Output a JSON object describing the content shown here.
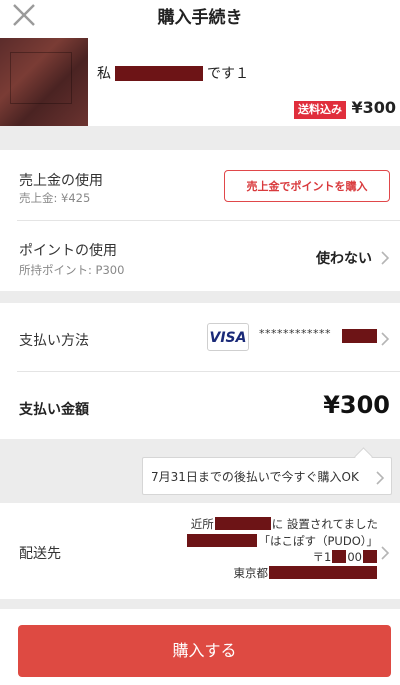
{
  "header": {
    "title": "購入手続き"
  },
  "item": {
    "name_prefix": "私",
    "name_suffix": "です１",
    "shipping_badge": "送料込み",
    "price": "¥300"
  },
  "sales": {
    "label": "売上金の使用",
    "sub_label": "売上金:",
    "sub_value": "¥425",
    "button_label": "売上金でポイントを購入"
  },
  "points": {
    "label": "ポイントの使用",
    "sub_label": "所持ポイント:",
    "sub_value": "P300",
    "value": "使わない"
  },
  "payment": {
    "label": "支払い方法",
    "card_brand": "VISA",
    "card_number_masked": "************"
  },
  "total": {
    "label": "支払い金額",
    "value": "¥300"
  },
  "tooltip": {
    "text": "7月31日までの後払いで今すぐ購入OK"
  },
  "shipping": {
    "label": "配送先",
    "line1_a": "近所",
    "line1_b": "に 設置されてました",
    "line2": "「はこぽす（PUDO）」",
    "line3_a": "〒1",
    "line3_b": "00",
    "line4": "東京都"
  },
  "purchase": {
    "button_label": "購入する"
  },
  "colors": {
    "accent": "#de4a42",
    "badge": "#e02e3c",
    "redaction": "#6d1416",
    "background": "#ececec"
  }
}
